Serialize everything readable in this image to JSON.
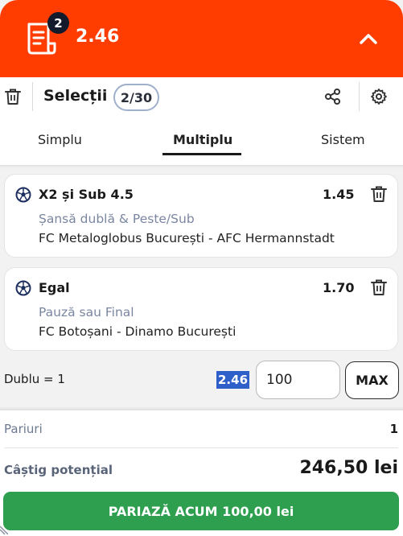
{
  "topbar": {
    "selection_count": "2",
    "total_odds": "2.46",
    "icons": {
      "ticket": "ticket-icon",
      "collapse": "chevron-up-icon"
    }
  },
  "header": {
    "title": "Selecții",
    "count": "2/30",
    "icons": {
      "delete_all": "trash-icon",
      "share": "share-icon",
      "settings": "gear-icon"
    },
    "tabs": [
      {
        "label": "Simplu",
        "active": false
      },
      {
        "label": "Multiplu",
        "active": true
      },
      {
        "label": "Sistem",
        "active": false
      }
    ]
  },
  "selections": [
    {
      "name": "X2 și Sub 4.5",
      "odds": "1.45",
      "market": "Șansă dublă & Peste/Sub",
      "event": "FC Metaloglobus București - AFC Hermannstadt"
    },
    {
      "name": "Egal",
      "odds": "1.70",
      "market": "Pauză sau Final",
      "event": "FC Botoșani - Dinamo București"
    }
  ],
  "stake": {
    "combo_label": "Dublu = 1",
    "combo_odds": "2.46",
    "amount": "100",
    "max_label": "MAX"
  },
  "summary": {
    "bets_label": "Pariuri",
    "bets_value": "1",
    "win_label": "Câștig potențial",
    "win_value": "246,50 lei",
    "place_button": "PARIAZĂ ACUM 100,00 lei"
  },
  "colors": {
    "brand": "#ff3d00",
    "place_button": "#2e9e4f",
    "highlight": "#2f5fc8",
    "muted_text": "#7a86a0"
  }
}
